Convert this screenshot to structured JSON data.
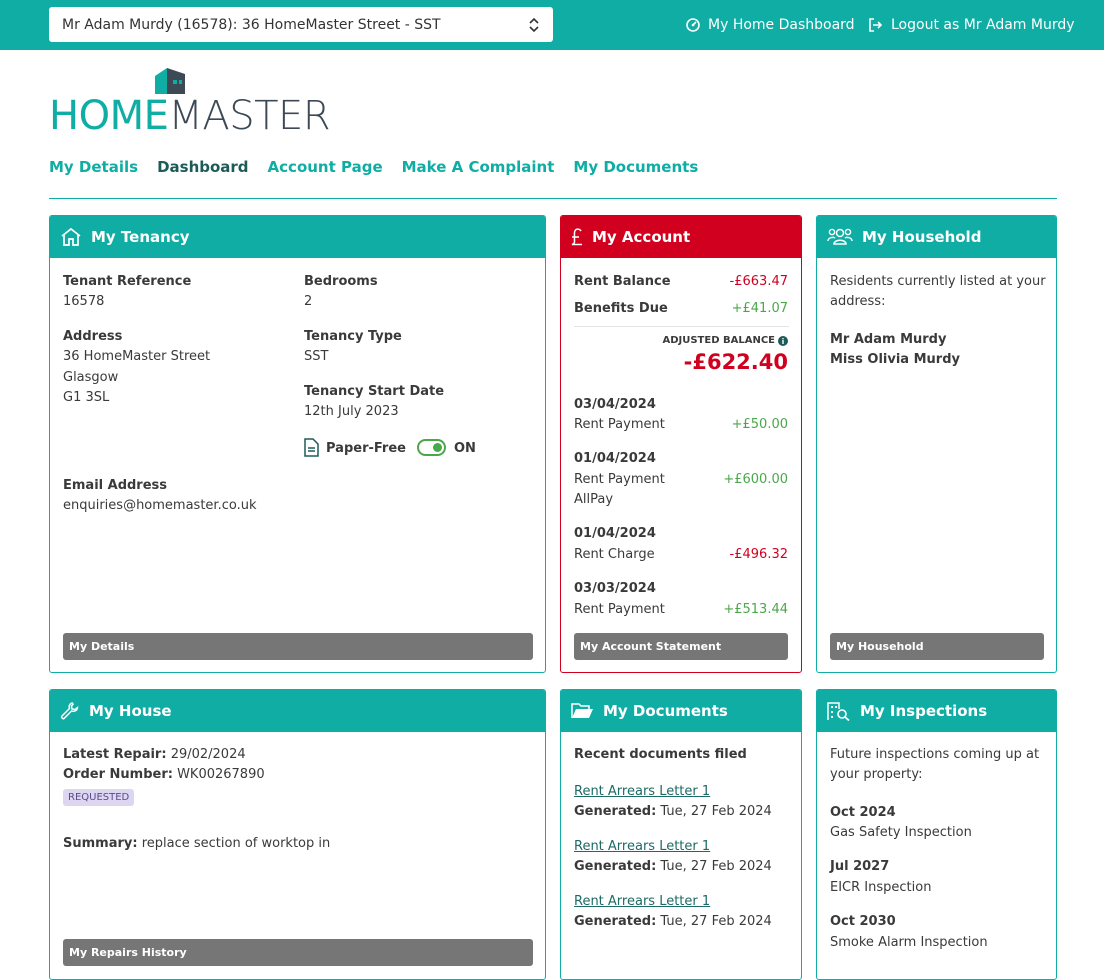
{
  "topbar": {
    "tenant_select": "Mr Adam Murdy (16578): 36 HomeMaster Street - SST",
    "dashboard_link": "My Home Dashboard",
    "logout_link": "Logout as Mr Adam Murdy"
  },
  "logo": {
    "part1": "HOME",
    "part2": "MASTER"
  },
  "nav": [
    "My Details",
    "Dashboard",
    "Account Page",
    "Make A Complaint",
    "My Documents"
  ],
  "tenancy": {
    "title": "My Tenancy",
    "tenant_ref_label": "Tenant Reference",
    "tenant_ref": "16578",
    "bedrooms_label": "Bedrooms",
    "bedrooms": "2",
    "address_label": "Address",
    "address": [
      "36 HomeMaster Street",
      "Glasgow",
      "G1 3SL"
    ],
    "tenancy_type_label": "Tenancy Type",
    "tenancy_type": "SST",
    "start_label": "Tenancy Start Date",
    "start": "12th July 2023",
    "paper_free_label": "Paper-Free",
    "paper_free_state": "ON",
    "email_label": "Email Address",
    "email": "enquiries@homemaster.co.uk",
    "button": "My Details"
  },
  "account": {
    "title": "My Account",
    "rent_balance_label": "Rent Balance",
    "rent_balance": "-£663.47",
    "benefits_label": "Benefits Due",
    "benefits": "+£41.07",
    "adjusted_label": "ADJUSTED BALANCE",
    "adjusted": "-£622.40",
    "transactions": [
      {
        "date": "03/04/2024",
        "desc": "Rent Payment",
        "desc2": "",
        "amount": "+£50.00"
      },
      {
        "date": "01/04/2024",
        "desc": "Rent Payment",
        "desc2": "AllPay",
        "amount": "+£600.00"
      },
      {
        "date": "01/04/2024",
        "desc": "Rent Charge",
        "desc2": "",
        "amount": "-£496.32"
      },
      {
        "date": "03/03/2024",
        "desc": "Rent Payment",
        "desc2": "",
        "amount": "+£513.44"
      }
    ],
    "button": "My Account Statement"
  },
  "household": {
    "title": "My Household",
    "intro_line1": "Residents currently listed at your",
    "intro_line2": "address:",
    "residents": [
      "Mr Adam Murdy",
      "Miss Olivia Murdy"
    ],
    "button": "My Household"
  },
  "house": {
    "title": "My House",
    "latest_repair_label": "Latest Repair:",
    "latest_repair": "29/02/2024",
    "order_label": "Order Number:",
    "order": "WK00267890",
    "status": "REQUESTED",
    "summary_label": "Summary:",
    "summary": "replace section of worktop in",
    "button": "My Repairs History"
  },
  "documents": {
    "title": "My Documents",
    "heading": "Recent documents filed",
    "generated_label": "Generated:",
    "items": [
      {
        "name": "Rent Arrears Letter 1",
        "date": "Tue, 27 Feb 2024"
      },
      {
        "name": "Rent Arrears Letter 1",
        "date": "Tue, 27 Feb 2024"
      },
      {
        "name": "Rent Arrears Letter 1",
        "date": "Tue, 27 Feb 2024"
      }
    ]
  },
  "inspections": {
    "title": "My Inspections",
    "intro_line1": "Future inspections coming up at",
    "intro_line2": "your property:",
    "items": [
      {
        "date": "Oct 2024",
        "name": "Gas Safety Inspection"
      },
      {
        "date": "Jul 2027",
        "name": "EICR Inspection"
      },
      {
        "date": "Oct 2030",
        "name": "Smoke Alarm Inspection"
      }
    ]
  },
  "colors": {
    "teal": "#0fada4",
    "red": "#d1001f",
    "positive": "#4aa84a",
    "button_grey": "#767676"
  }
}
